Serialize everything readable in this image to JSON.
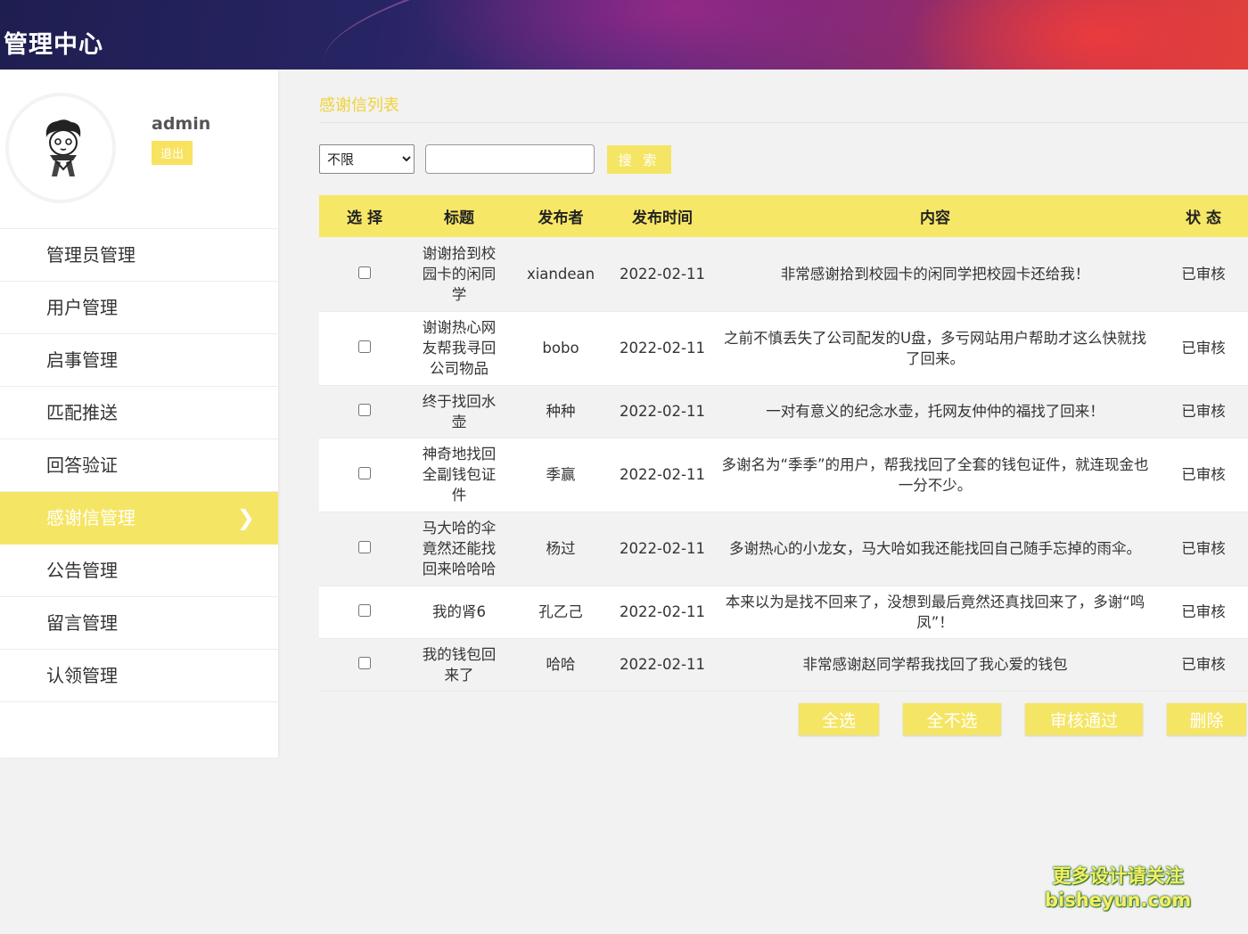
{
  "header": {
    "title": "管理中心"
  },
  "profile": {
    "username": "admin",
    "logout_label": "退出"
  },
  "nav": {
    "items": [
      {
        "label": "管理员管理"
      },
      {
        "label": "用户管理"
      },
      {
        "label": "启事管理"
      },
      {
        "label": "匹配推送"
      },
      {
        "label": "回答验证"
      },
      {
        "label": "感谢信管理",
        "active": true
      },
      {
        "label": "公告管理"
      },
      {
        "label": "留言管理"
      },
      {
        "label": "认领管理"
      }
    ],
    "active_chevron": "❯"
  },
  "page": {
    "title": "感谢信列表"
  },
  "filter": {
    "selected": "不限",
    "search_value": "",
    "search_label": "搜 索"
  },
  "table": {
    "columns": [
      "选 择",
      "标题",
      "发布者",
      "发布时间",
      "内容",
      "状 态"
    ],
    "rows": [
      {
        "title": "谢谢拾到校园卡的闲同学",
        "author": "xiandean",
        "time": "2022-02-11",
        "content": "非常感谢拾到校园卡的闲同学把校园卡还给我！",
        "status": "已审核"
      },
      {
        "title": "谢谢热心网友帮我寻回公司物品",
        "author": "bobo",
        "time": "2022-02-11",
        "content": "之前不慎丢失了公司配发的U盘，多亏网站用户帮助才这么快就找了回来。",
        "status": "已审核"
      },
      {
        "title": "终于找回水壶",
        "author": "种种",
        "time": "2022-02-11",
        "content": "一对有意义的纪念水壶，托网友仲仲的福找了回来！",
        "status": "已审核"
      },
      {
        "title": "神奇地找回全副钱包证件",
        "author": "季赢",
        "time": "2022-02-11",
        "content": "多谢名为“季季”的用户，帮我找回了全套的钱包证件，就连现金也一分不少。",
        "status": "已审核"
      },
      {
        "title": "马大哈的伞竟然还能找回来哈哈哈",
        "author": "杨过",
        "time": "2022-02-11",
        "content": "多谢热心的小龙女，马大哈如我还能找回自己随手忘掉的雨伞。",
        "status": "已审核"
      },
      {
        "title": "我的肾6",
        "author": "孔乙己",
        "time": "2022-02-11",
        "content": "本来以为是找不回来了，没想到最后竟然还真找回来了，多谢“鸣凤”！",
        "status": "已审核"
      },
      {
        "title": "我的钱包回来了",
        "author": "哈哈",
        "time": "2022-02-11",
        "content": "非常感谢赵同学帮我找回了我心爱的钱包",
        "status": "已审核"
      }
    ]
  },
  "actions": {
    "select_all": "全选",
    "deselect_all": "全不选",
    "approve": "审核通过",
    "delete": "删除"
  },
  "watermark": {
    "line1": "更多设计请关注",
    "line2": "bisheyun.com"
  },
  "colors": {
    "accent": "#f5e564",
    "title_text": "#f0d23a"
  }
}
